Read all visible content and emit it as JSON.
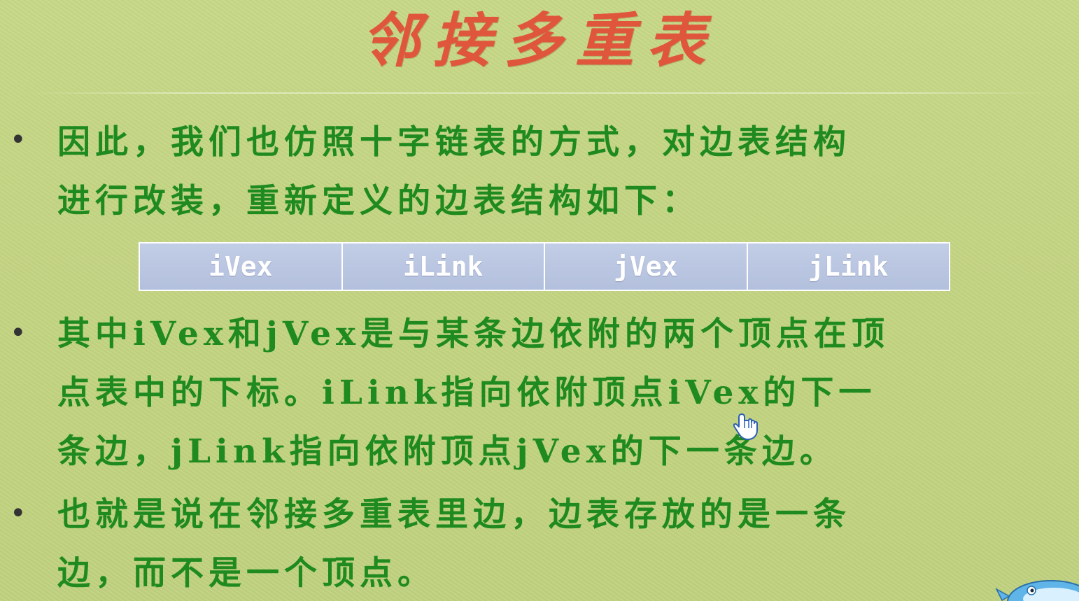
{
  "slide": {
    "title": "邻接多重表",
    "bullets": [
      {
        "lines": [
          "因此，我们也仿照十字链表的方式，对边表结构",
          "进行改装，重新定义的边表结构如下："
        ]
      },
      {
        "lines": [
          "其中iVex和jVex是与某条边依附的两个顶点在顶",
          "点表中的下标。iLink指向依附顶点iVex的下一",
          "条边，jLink指向依附顶点jVex的下一条边。"
        ]
      },
      {
        "lines": [
          "也就是说在邻接多重表里边，边表存放的是一条",
          "边，而不是一个顶点。"
        ]
      }
    ],
    "edge_node_fields": [
      "iVex",
      "iLink",
      "jVex",
      "jLink"
    ]
  },
  "colors": {
    "background": "#c3d482",
    "title": "#e0563c",
    "body_text": "#1f8a1f",
    "table_cell": "#b9c5e0",
    "table_text": "#ffffff"
  },
  "icons": {
    "cursor": "hand-pointer-icon",
    "corner": "fish-mascot-icon"
  }
}
